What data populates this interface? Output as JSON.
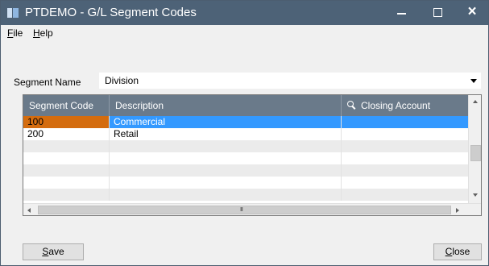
{
  "window": {
    "title": "PTDEMO - G/L Segment Codes",
    "controls": {
      "minimize": "minimize",
      "maximize": "maximize",
      "close": "×"
    }
  },
  "menu": {
    "items": [
      {
        "accel": "F",
        "rest": "ile"
      },
      {
        "accel": "H",
        "rest": "elp"
      }
    ]
  },
  "segment": {
    "label": "Segment Name",
    "value": "Division"
  },
  "grid": {
    "columns": [
      "Segment Code",
      "Description",
      "Closing Account"
    ],
    "rows": [
      {
        "code": "100",
        "description": "Commercial",
        "closing_account": ""
      },
      {
        "code": "200",
        "description": "Retail",
        "closing_account": ""
      }
    ],
    "scroll_grip": "III"
  },
  "buttons": {
    "save": {
      "accel": "S",
      "rest": "ave"
    },
    "close": {
      "accel": "C",
      "rest": "lose"
    }
  },
  "colors": {
    "titlebar": "#4d6277",
    "header": "#6a7a8a",
    "selected_row": "#3399ff",
    "selected_key_cell": "#d46c0e"
  },
  "icons": {
    "app": "app-icon",
    "search": "search-icon"
  }
}
